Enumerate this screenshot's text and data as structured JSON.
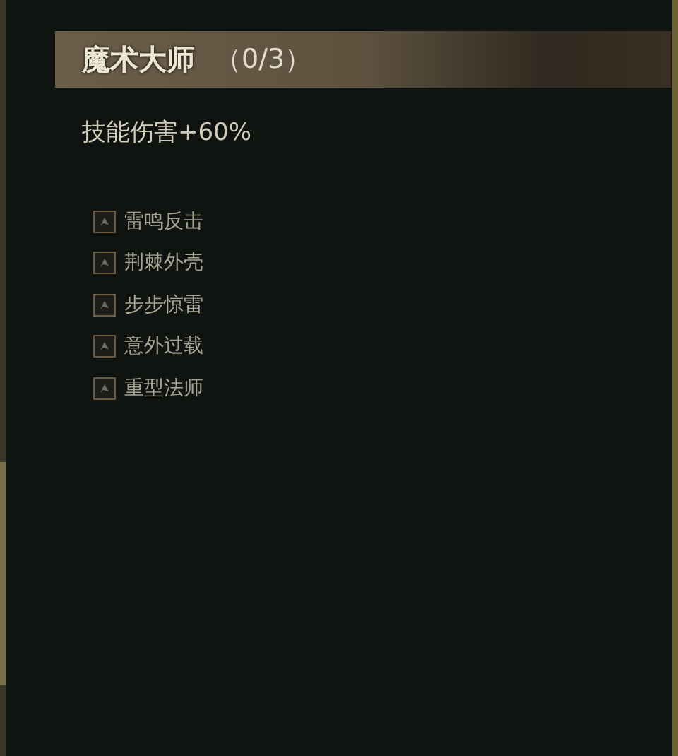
{
  "talent": {
    "name": "魔术大师",
    "count": "（0/3）",
    "effect": "技能伤害+60%"
  },
  "skills": [
    {
      "name": "雷鸣反击"
    },
    {
      "name": "荆棘外壳"
    },
    {
      "name": "步步惊雷"
    },
    {
      "name": "意外过载"
    },
    {
      "name": "重型法师"
    }
  ]
}
